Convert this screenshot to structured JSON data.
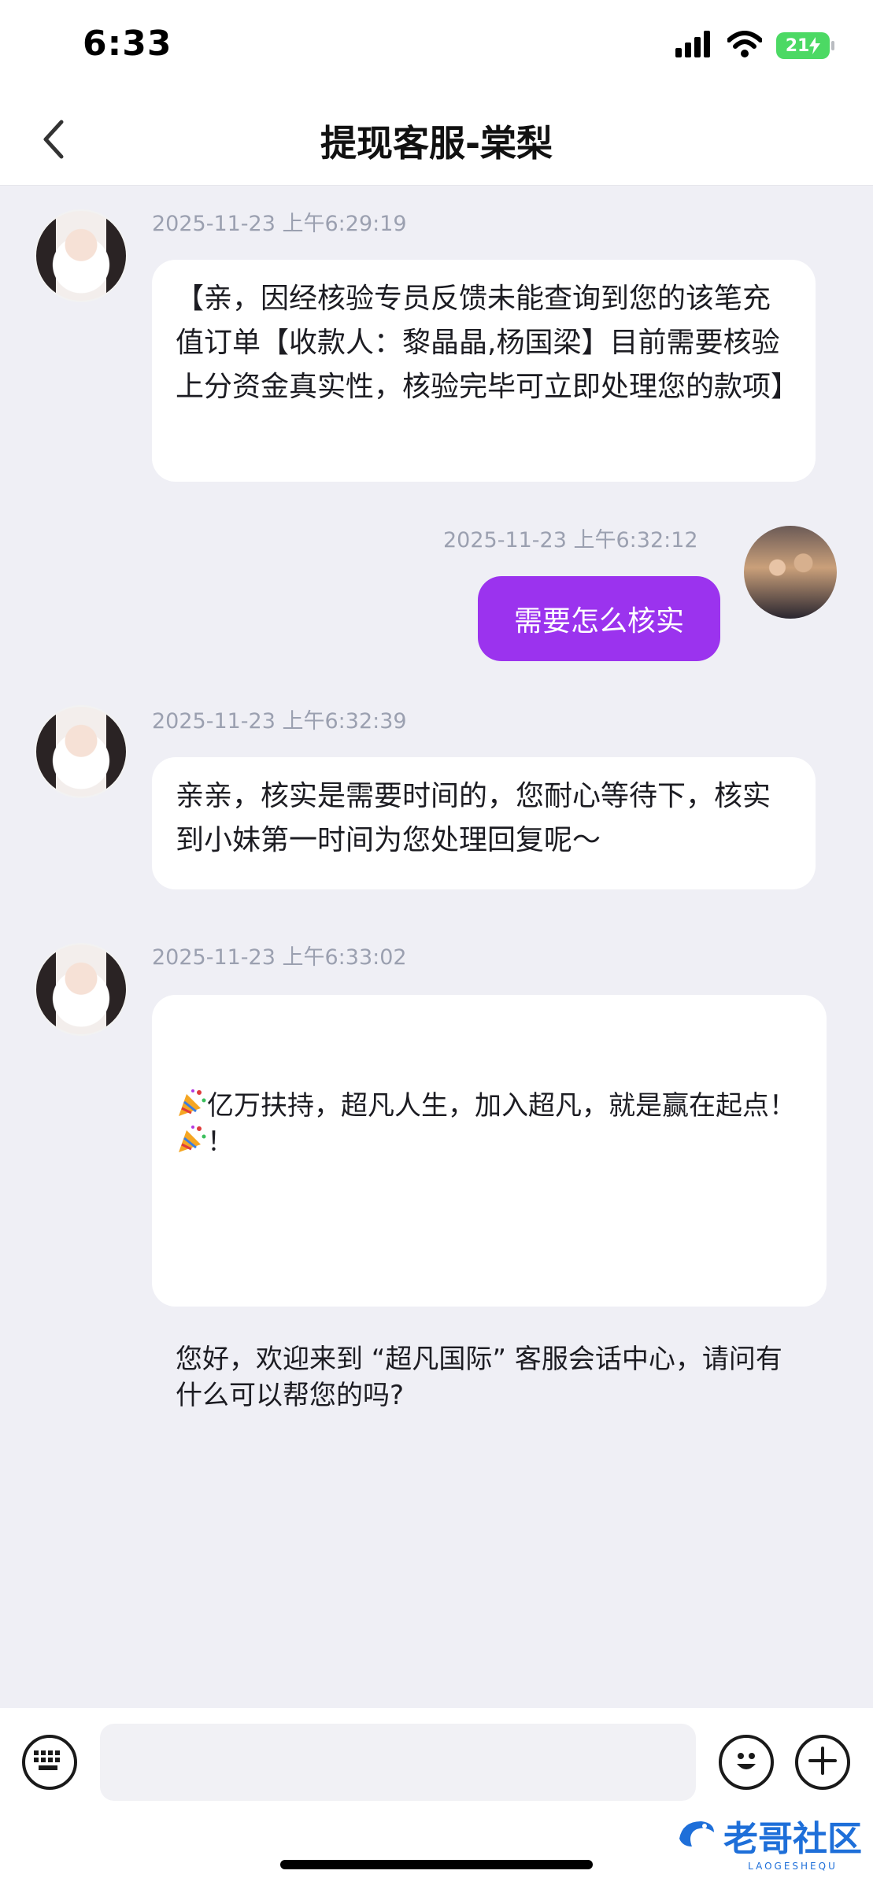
{
  "status_bar": {
    "time": "6:33",
    "battery": "21",
    "icons": [
      "signal-icon",
      "wifi-icon",
      "battery-charging-icon"
    ]
  },
  "nav": {
    "title": "提现客服-棠梨",
    "back_icon": "chevron-left-icon"
  },
  "messages": [
    {
      "sender": "agent",
      "timestamp": "2025-11-23 上午6:29:19",
      "text": "【亲，因经核验专员反馈未能查询到您的该笔充值订单【收款人：黎晶晶,杨国梁】目前需要核验上分资金真实性，核验完毕可立即处理您的款项】"
    },
    {
      "sender": "user",
      "timestamp": "2025-11-23 上午6:32:12",
      "text": "需要怎么核实"
    },
    {
      "sender": "agent",
      "timestamp": "2025-11-23 上午6:32:39",
      "text": "亲亲，核实是需要时间的，您耐心等待下，核实到小妹第一时间为您处理回复呢～"
    },
    {
      "sender": "agent",
      "timestamp": "2025-11-23 上午6:33:02",
      "line1": "亿万扶持，超凡人生，加入超凡，就是赢在起点！",
      "line1_suffix": "！",
      "line2": "您好，欢迎来到 “超凡国际” 客服会话中心，请问有什么可以帮您的吗?"
    }
  ],
  "input_bar": {
    "placeholder": "",
    "left_icon": "keyboard-icon",
    "right_icons": [
      "emoji-icon",
      "plus-icon"
    ]
  },
  "watermark": {
    "title": "老哥社区",
    "subtitle": "LAOGESHEQU"
  },
  "colors": {
    "accent": "#9b33ee",
    "background": "#efeff5",
    "bubble": "#ffffff",
    "battery": "#4cd964"
  }
}
